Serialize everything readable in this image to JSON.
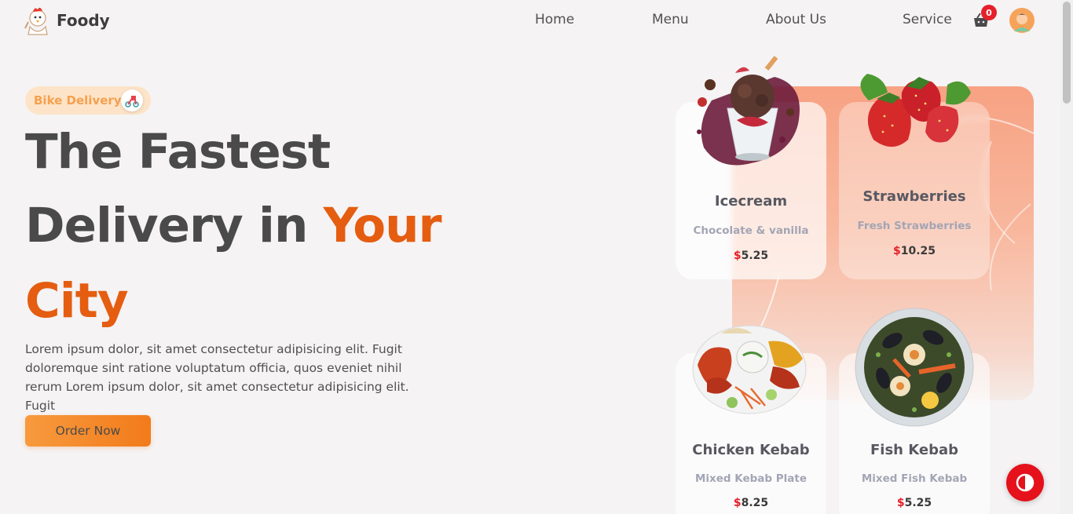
{
  "header": {
    "brand": "Foody",
    "nav": [
      {
        "label": "Home"
      },
      {
        "label": "Menu"
      },
      {
        "label": "About Us"
      },
      {
        "label": "Service"
      }
    ],
    "cart_count": "0"
  },
  "hero": {
    "badge": "Bike Delivery",
    "line1": "The Fastest",
    "line2_a": "Delivery in ",
    "line2_b": "Your",
    "line3": "City",
    "description": "Lorem ipsum dolor, sit amet consectetur adipisicing elit. Fugit doloremque sint ratione voluptatum officia, quos eveniet nihil rerum Lorem ipsum dolor, sit amet consectetur adipisicing elit. Fugit",
    "cta": "Order Now"
  },
  "cards": [
    {
      "title": "Icecream",
      "subtitle": "Chocolate & vanilla",
      "currency": "$",
      "price": "5.25",
      "icon": "icecream-image"
    },
    {
      "title": "Strawberries",
      "subtitle": "Fresh Strawberries",
      "currency": "$",
      "price": "10.25",
      "icon": "strawberries-image"
    },
    {
      "title": "Chicken Kebab",
      "subtitle": "Mixed Kebab Plate",
      "currency": "$",
      "price": "8.25",
      "icon": "chicken-kebab-image"
    },
    {
      "title": "Fish Kebab",
      "subtitle": "Mixed Fish Kebab",
      "currency": "$",
      "price": "5.25",
      "icon": "fish-kebab-image"
    }
  ],
  "colors": {
    "accent": "#e55d10",
    "button": "#f27b1a",
    "badge_bg": "#fde4c8",
    "price_currency": "#e5202a",
    "float_button": "#e5111b"
  }
}
